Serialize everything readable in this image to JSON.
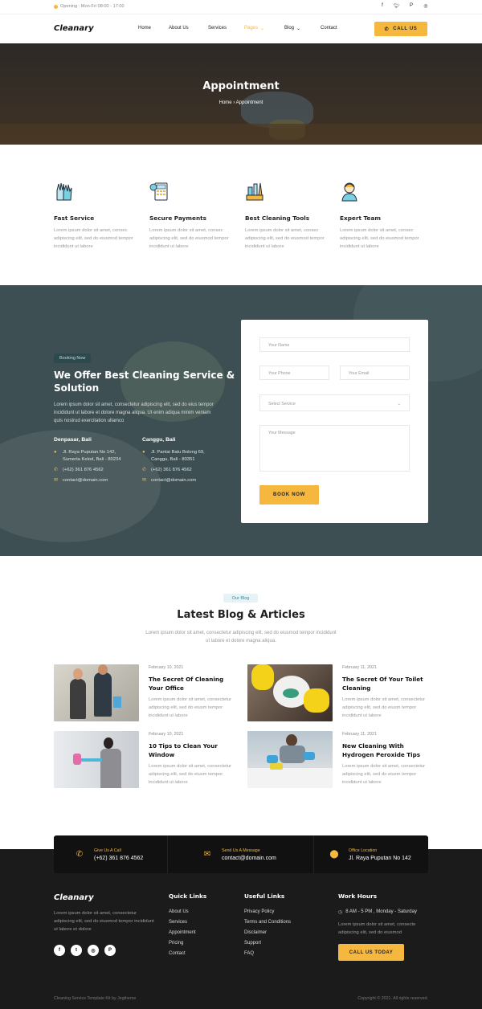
{
  "topbar": {
    "opening": "Opening : Mon-Fri 08:00 - 17:00",
    "social_icons": [
      "facebook-icon",
      "twitter-icon",
      "pinterest-icon",
      "instagram-icon"
    ]
  },
  "nav": {
    "logo": "Cleanary",
    "items": [
      {
        "label": "Home",
        "dropdown": false
      },
      {
        "label": "About Us",
        "dropdown": false
      },
      {
        "label": "Services",
        "dropdown": false
      },
      {
        "label": "Pages",
        "dropdown": true,
        "active": true
      },
      {
        "label": "Blog",
        "dropdown": true
      },
      {
        "label": "Contact",
        "dropdown": false
      }
    ],
    "call_label": "CALL US"
  },
  "hero": {
    "title": "Appointment",
    "crumb_home": "Home",
    "crumb_current": "Appointment"
  },
  "features": [
    {
      "icon": "gloves-icon",
      "title": "Fast Service",
      "desc": "Lorem ipsum dolor sit amet, consec adipiscing elit, sed do eiusmod tempor incididunt ut labore"
    },
    {
      "icon": "payment-icon",
      "title": "Secure Payments",
      "desc": "Lorem ipsum dolor sit amet, consec adipiscing elit, sed do eiusmod tempor incididunt ut labore"
    },
    {
      "icon": "cleaning-tools-icon",
      "title": "Best Cleaning Tools",
      "desc": "Lorem ipsum dolor sit amet, consec adipiscing elit, sed do eiusmod tempor incididunt ut labore"
    },
    {
      "icon": "cleaner-person-icon",
      "title": "Expert Team",
      "desc": "Lorem ipsum dolor sit amet, consec adipiscing elit, sed do eiusmod tempor incididunt ut labore"
    }
  ],
  "booking": {
    "pill": "Booking Now",
    "title": "We Offer Best Cleaning Service & Solution",
    "desc": "Lorem ipsum dolor sit amet, consectetur adipiscing elit, sed do eius tempor incididunt ut labore et dolore magna aliqua. Ut enim adiqua minim veniam quis nostrud exercitation ullamco",
    "locations": [
      {
        "city": "Denpasar, Bali",
        "address1": "Jl. Raya Puputan No 142,",
        "address2": "Sumerta Kelod, Bali - 80234",
        "phone": "(+62) 361 876 4562",
        "email": "contact@domain.com"
      },
      {
        "city": "Canggu, Bali",
        "address1": "Jl. Pantai Batu Bolong 69,",
        "address2": "Canggu, Bali - 80351",
        "phone": "(+62) 361 876 4562",
        "email": "contact@domain.com"
      }
    ],
    "form": {
      "name_placeholder": "Your Name",
      "phone_placeholder": "Your Phone",
      "email_placeholder": "Your Email",
      "service_selected": "Select Service",
      "message_placeholder": "Your Message",
      "submit_label": "BOOK NOW"
    }
  },
  "blog": {
    "pill": "Our Blog",
    "title": "Latest Blog & Articles",
    "subtitle": "Lorem ipsum dolor sit amet, consectetur adipiscing elit, sed do eiusmod tempor incididunt ut labore et dolore magna aliqua.",
    "posts": [
      {
        "date": "February 10, 2021",
        "title": "The Secret Of Cleaning Your Office",
        "excerpt": "Lorem ipsum dolor sit amet, consectetur adipiscing elit, sed do eiusm tempor incididunt ut labore"
      },
      {
        "date": "February 11, 2021",
        "title": "The Secret Of Your Toilet Cleaning",
        "excerpt": "Lorem ipsum dolor sit amet, consectetur adipiscing elit, sed do eiusm tempor incididunt ut labore"
      },
      {
        "date": "February 10, 2021",
        "title": "10 Tips to Clean Your Window",
        "excerpt": "Lorem ipsum dolor sit amet, consectetur adipiscing elit, sed do eiusm tempor incididunt ut labore"
      },
      {
        "date": "February 11, 2021",
        "title": "New Cleaning With Hydrogen Peroxide Tips",
        "excerpt": "Lorem ipsum dolor sit amet, consectetur adipiscing elit, sed do eiusm tempor incididunt ut labore"
      }
    ]
  },
  "contact_bar": [
    {
      "icon": "phone-icon",
      "label": "Give Us A Call",
      "value": "(+62) 361 876 4562"
    },
    {
      "icon": "envelope-icon",
      "label": "Send Us A Message",
      "value": "contact@domain.com"
    },
    {
      "icon": "map-pin-icon",
      "label": "Office Location",
      "value": "Jl. Raya Puputan No 142"
    }
  ],
  "footer": {
    "logo": "Cleanary",
    "about": "Lorem ipsum dolor sit amet, consectetur adipiscing elit, sed do eiusmod tempor incididunt ut labore et dolore",
    "quick_links_title": "Quick Links",
    "quick_links": [
      "About Us",
      "Services",
      "Appointment",
      "Pricing",
      "Contact"
    ],
    "useful_links_title": "Useful Links",
    "useful_links": [
      "Privacy Policy",
      "Terms and Conditions",
      "Disclaimer",
      "Support",
      "FAQ"
    ],
    "hours_title": "Work Hours",
    "hours": "8 AM - 5 PM , Monday - Saturday",
    "hours_desc": "Lorem ipsum dolor sit amet, consecte adipiscing elit, sed do eiusmod",
    "cta_label": "CALL US TODAY",
    "credit": "Cleaning Service Template Kit by Jegtheme",
    "copyright": "Copyright © 2021. All rights reserved."
  },
  "colors": {
    "accent": "#f5b73d",
    "dark": "#1b1b1b",
    "teal_bg": "#3d4f52"
  }
}
